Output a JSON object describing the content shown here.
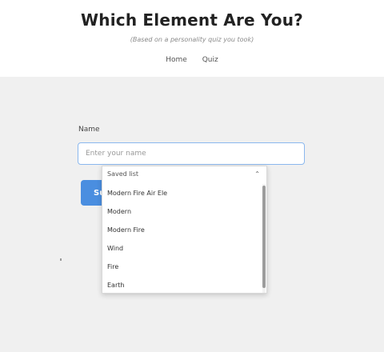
{
  "header": {
    "title": "Which Element Are You?",
    "subtitle": "(Based on a personality quiz you took)",
    "nav": [
      {
        "label": "Home"
      },
      {
        "label": "Quiz"
      }
    ]
  },
  "form": {
    "name_label": "Name",
    "name_placeholder": "Enter your name",
    "submit_label": "Submit"
  },
  "dropdown": {
    "header": "Saved list",
    "close_label": "⌃",
    "options": [
      "Modern Fire Air Ele",
      "Modern",
      "Modern Fire",
      "Wind",
      "Fire",
      "Earth"
    ]
  }
}
